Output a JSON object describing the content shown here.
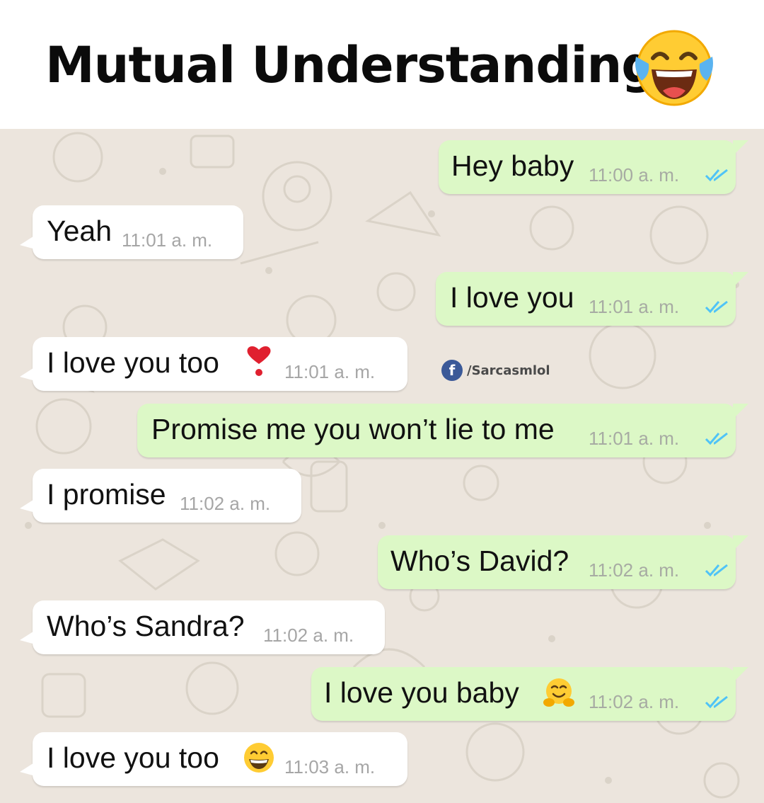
{
  "header": {
    "title": "Mutual Understanding",
    "title_emoji": "face-with-tears-of-joy-icon"
  },
  "watermark": {
    "icon": "facebook-icon",
    "text": "/Sarcasmlol"
  },
  "colors": {
    "chat_background": "#ece5dd",
    "outgoing_bubble": "#dcf8c6",
    "incoming_bubble": "#ffffff",
    "read_ticks": "#4fc3f7",
    "timestamp": "#a7aba3"
  },
  "messages": [
    {
      "direction": "outgoing",
      "text": "Hey baby",
      "time": "11:00 a. m.",
      "status": "read-double-check-icon"
    },
    {
      "direction": "incoming",
      "text": "Yeah",
      "time": "11:01 a. m."
    },
    {
      "direction": "outgoing",
      "text": "I love you",
      "time": "11:01 a. m.",
      "status": "read-double-check-icon"
    },
    {
      "direction": "incoming",
      "text": "I love you too",
      "emoji": "red-exclamation-heart-icon",
      "time": "11:01 a. m."
    },
    {
      "direction": "outgoing",
      "text": "Promise me you won’t lie to me",
      "time": "11:01 a. m.",
      "status": "read-double-check-icon"
    },
    {
      "direction": "incoming",
      "text": "I promise",
      "time": "11:02 a. m."
    },
    {
      "direction": "outgoing",
      "text": "Who’s David?",
      "time": "11:02 a. m.",
      "status": "read-double-check-icon"
    },
    {
      "direction": "incoming",
      "text": "Who’s Sandra?",
      "time": "11:02 a. m."
    },
    {
      "direction": "outgoing",
      "text": "I love you baby",
      "emoji": "hugging-face-icon",
      "time": "11:02 a. m.",
      "status": "read-double-check-icon"
    },
    {
      "direction": "incoming",
      "text": "I love you too",
      "emoji": "grinning-face-icon",
      "time": "11:03 a. m."
    }
  ]
}
